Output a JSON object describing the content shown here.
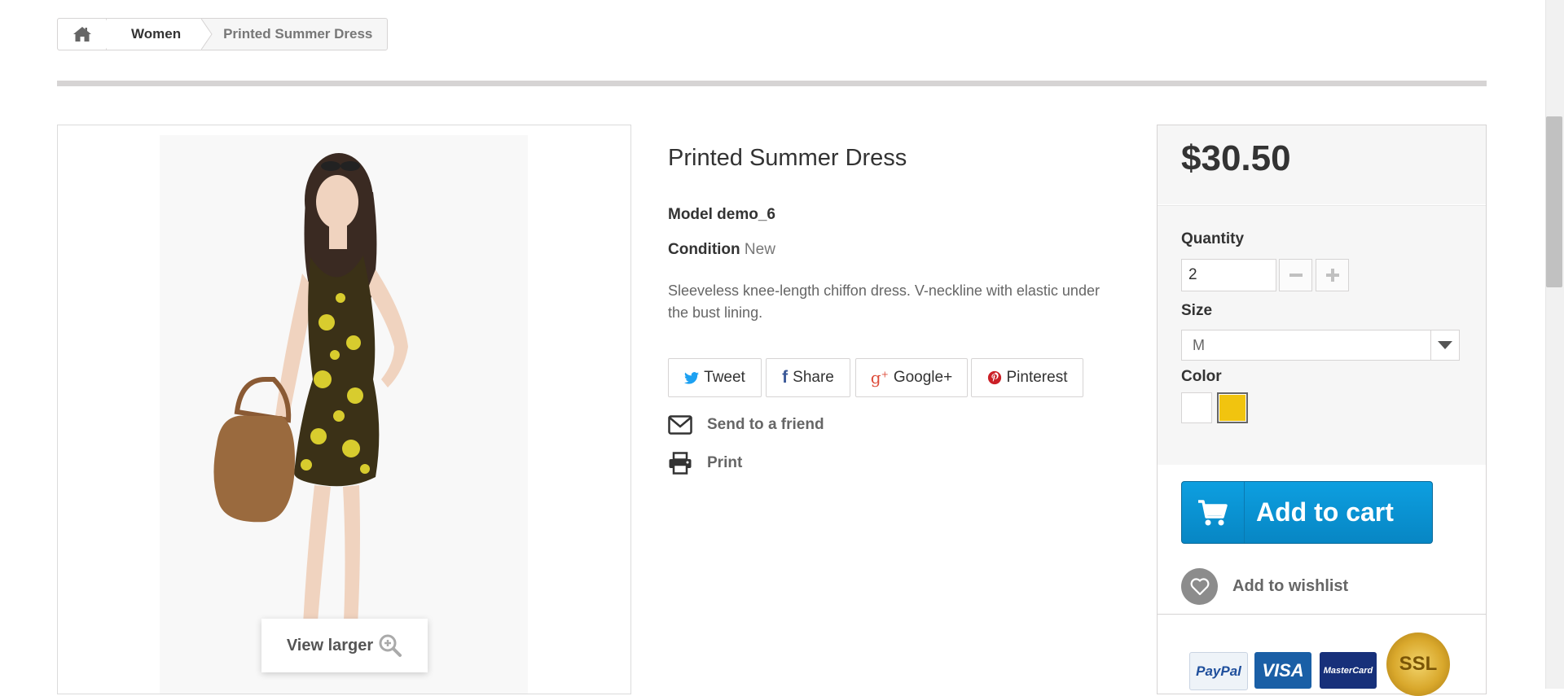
{
  "breadcrumb": {
    "home_icon": "home-icon",
    "category": "Women",
    "current": "Printed Summer Dress"
  },
  "product": {
    "title": "Printed Summer Dress",
    "model_label": "Model",
    "model_value": "demo_6",
    "condition_label": "Condition",
    "condition_value": "New",
    "description": "Sleeveless knee-length chiffon dress. V-neckline with elastic under the bust lining.",
    "view_larger": "View larger"
  },
  "social": {
    "tweet": "Tweet",
    "share": "Share",
    "google": "Google+",
    "pinterest": "Pinterest"
  },
  "actions": {
    "send_to_friend": "Send to a friend",
    "print": "Print"
  },
  "buy": {
    "price": "$30.50",
    "quantity_label": "Quantity",
    "quantity_value": "2",
    "size_label": "Size",
    "size_value": "M",
    "color_label": "Color",
    "colors": [
      "#ffffff",
      "#f1c40f"
    ],
    "selected_color": "#f1c40f",
    "add_to_cart": "Add to cart",
    "add_to_wishlist": "Add to wishlist"
  },
  "payment": {
    "paypal": "PayPal",
    "visa": "VISA",
    "mastercard": "MasterCard",
    "ssl": "SSL"
  },
  "colors": {
    "accent": "#0995d6",
    "border": "#d6d4d4",
    "panel_bg": "#f6f6f6"
  }
}
